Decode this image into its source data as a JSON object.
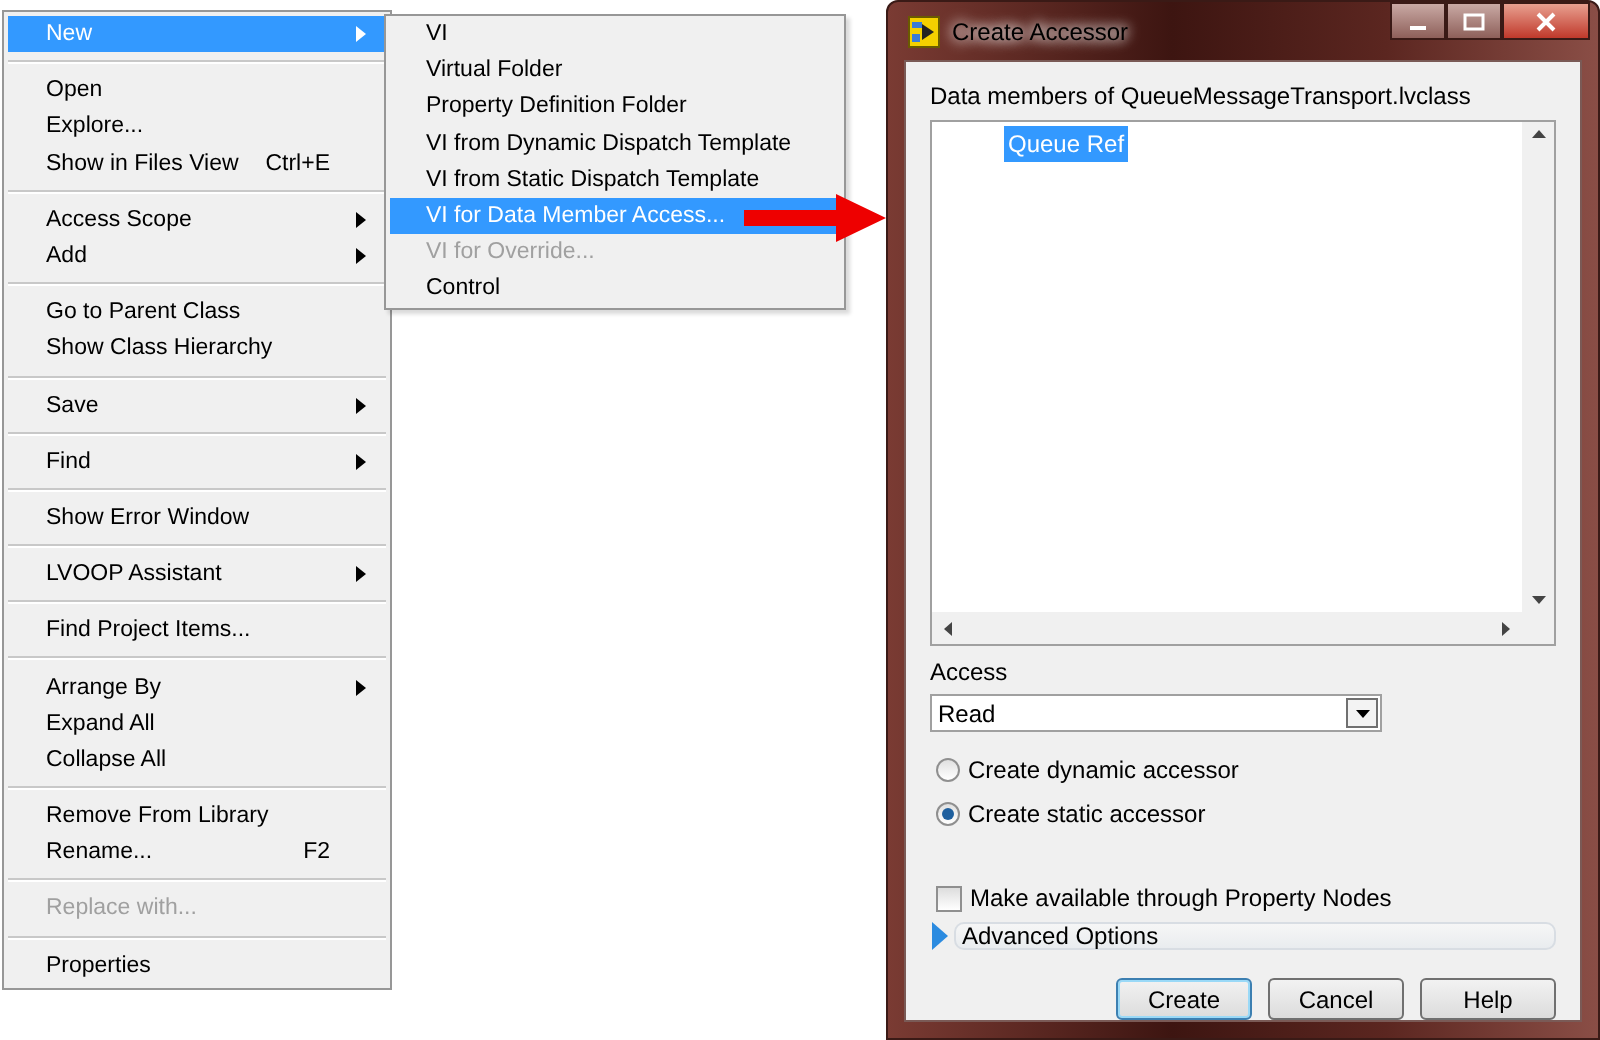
{
  "context_menu": {
    "groups": [
      [
        {
          "label": "New",
          "submenu": true,
          "highlighted": true,
          "disabled": false
        }
      ],
      [
        {
          "label": "Open",
          "submenu": false,
          "highlighted": false,
          "disabled": false
        },
        {
          "label": "Explore...",
          "submenu": false,
          "highlighted": false,
          "disabled": false
        },
        {
          "label": "Show in Files View",
          "shortcut": "Ctrl+E",
          "submenu": false,
          "highlighted": false,
          "disabled": false
        }
      ],
      [
        {
          "label": "Access Scope",
          "submenu": true,
          "highlighted": false,
          "disabled": false
        },
        {
          "label": "Add",
          "submenu": true,
          "highlighted": false,
          "disabled": false
        }
      ],
      [
        {
          "label": "Go to Parent Class",
          "submenu": false,
          "highlighted": false,
          "disabled": false
        },
        {
          "label": "Show Class Hierarchy",
          "submenu": false,
          "highlighted": false,
          "disabled": false
        }
      ],
      [
        {
          "label": "Save",
          "submenu": true,
          "highlighted": false,
          "disabled": false
        }
      ],
      [
        {
          "label": "Find",
          "submenu": true,
          "highlighted": false,
          "disabled": false
        }
      ],
      [
        {
          "label": "Show Error Window",
          "submenu": false,
          "highlighted": false,
          "disabled": false
        }
      ],
      [
        {
          "label": "LVOOP Assistant",
          "submenu": true,
          "highlighted": false,
          "disabled": false
        }
      ],
      [
        {
          "label": "Find Project Items...",
          "submenu": false,
          "highlighted": false,
          "disabled": false
        }
      ],
      [
        {
          "label": "Arrange By",
          "submenu": true,
          "highlighted": false,
          "disabled": false
        },
        {
          "label": "Expand All",
          "submenu": false,
          "highlighted": false,
          "disabled": false
        },
        {
          "label": "Collapse All",
          "submenu": false,
          "highlighted": false,
          "disabled": false
        }
      ],
      [
        {
          "label": "Remove From Library",
          "submenu": false,
          "highlighted": false,
          "disabled": false
        },
        {
          "label": "Rename...",
          "shortcut": "F2",
          "submenu": false,
          "highlighted": false,
          "disabled": false
        }
      ],
      [
        {
          "label": "Replace with...",
          "submenu": false,
          "highlighted": false,
          "disabled": true
        }
      ],
      [
        {
          "label": "Properties",
          "submenu": false,
          "highlighted": false,
          "disabled": false
        }
      ]
    ]
  },
  "submenu": {
    "items": [
      {
        "label": "VI",
        "highlighted": false,
        "disabled": false
      },
      {
        "label": "Virtual Folder",
        "highlighted": false,
        "disabled": false
      },
      {
        "label": "Property Definition Folder",
        "highlighted": false,
        "disabled": false
      },
      {
        "label": "VI from Dynamic Dispatch Template",
        "highlighted": false,
        "disabled": false
      },
      {
        "label": "VI from Static Dispatch Template",
        "highlighted": false,
        "disabled": false
      },
      {
        "label": "VI for Data Member Access...",
        "highlighted": true,
        "disabled": false
      },
      {
        "label": "VI for Override...",
        "highlighted": false,
        "disabled": true
      },
      {
        "label": "Control",
        "highlighted": false,
        "disabled": false
      }
    ]
  },
  "dialog": {
    "title": "Create Accessor",
    "list_label": "Data members of QueueMessageTransport.lvclass",
    "members": [
      {
        "label": "Queue Ref",
        "selected": true
      }
    ],
    "access_label": "Access",
    "access_value": "Read",
    "radios": [
      {
        "label": "Create dynamic accessor",
        "selected": false
      },
      {
        "label": "Create static accessor",
        "selected": true
      }
    ],
    "checkbox": {
      "label": "Make available through Property Nodes",
      "checked": false
    },
    "advanced": {
      "label": "Advanced Options",
      "expanded": false
    },
    "buttons": [
      {
        "label": "Create",
        "default": true
      },
      {
        "label": "Cancel",
        "default": false
      },
      {
        "label": "Help",
        "default": false
      }
    ]
  }
}
